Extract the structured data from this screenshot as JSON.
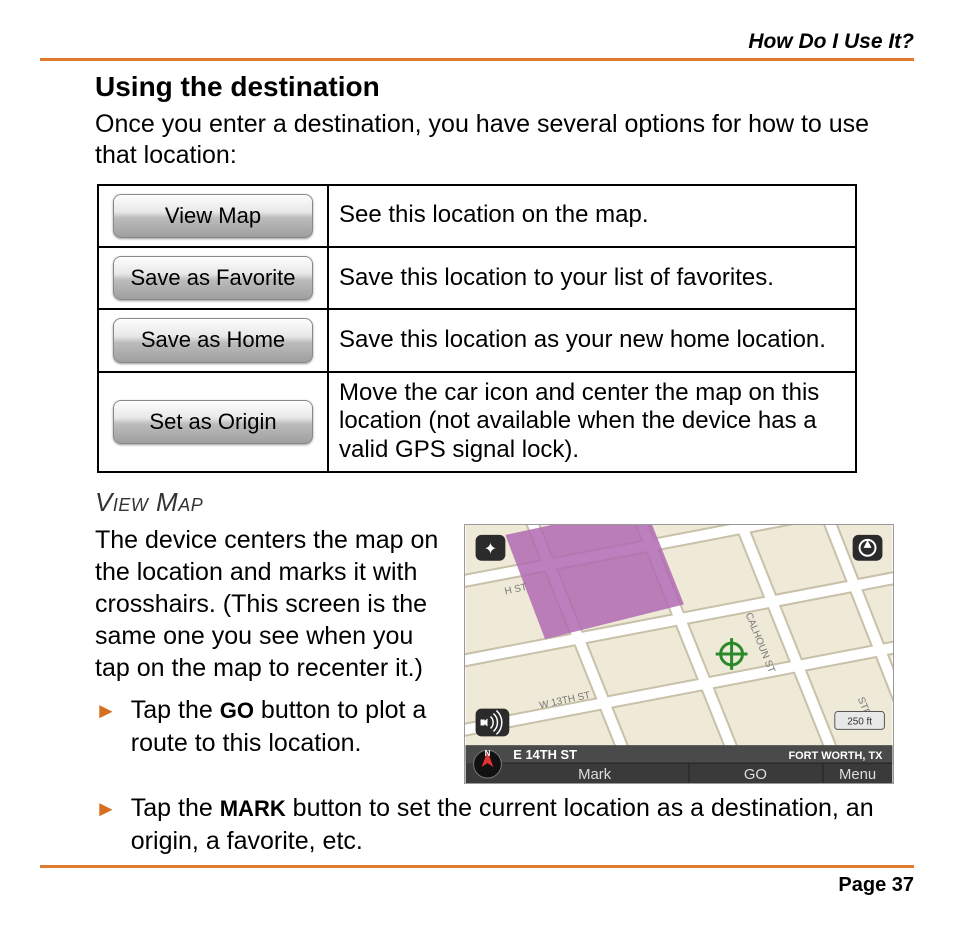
{
  "header": {
    "right": "How Do I Use It?"
  },
  "section": {
    "title": "Using the destination",
    "intro": "Once you enter a destination, you have several options for how to use that location:"
  },
  "options": [
    {
      "button": "View Map",
      "desc": "See this location on the map."
    },
    {
      "button": "Save as Favorite",
      "desc": "Save this location to your list of favorites."
    },
    {
      "button": "Save as Home",
      "desc": "Save this location as your new home location."
    },
    {
      "button": "Set as Origin",
      "desc": "Move the car icon and center the map on this location (not available when the device has a valid GPS signal lock)."
    }
  ],
  "viewmap": {
    "heading": "View Map",
    "body": "The device centers the map on the location and marks it with crosshairs. (This screen is the same one you see when you tap on the map to recenter it.)",
    "bullet1_pre": "Tap the ",
    "bullet1_bold": "GO",
    "bullet1_post": " button to plot a route to this location.",
    "bullet2_pre": "Tap the ",
    "bullet2_bold": "MARK",
    "bullet2_post": " button to set the current location as a destination, an origin, a favorite, etc."
  },
  "map": {
    "street_top": "H ST",
    "street_13": "W 13TH ST",
    "street_calhoun": "CALHOUN ST",
    "street_ste": "STE",
    "street_main": "E 14TH ST",
    "city": "FORT WORTH, TX",
    "btn_mark": "Mark",
    "btn_go": "GO",
    "btn_menu": "Menu",
    "scale": "250 ft"
  },
  "footer": {
    "page": "Page 37"
  }
}
